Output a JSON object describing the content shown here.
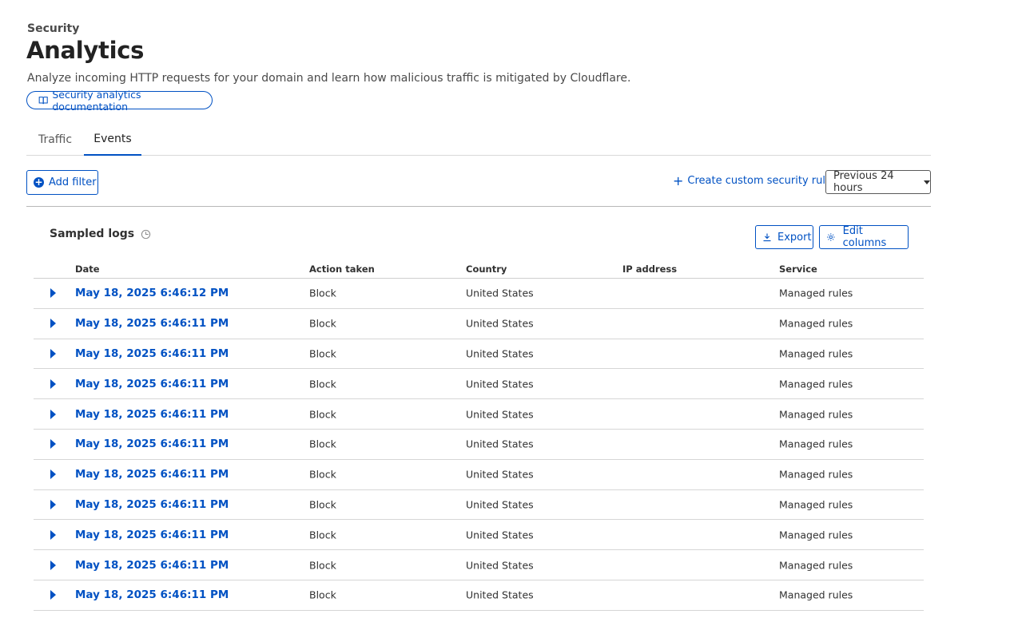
{
  "header": {
    "breadcrumb": "Security",
    "title": "Analytics",
    "description": "Analyze incoming HTTP requests for your domain and learn how malicious traffic is mitigated by Cloudflare.",
    "doc_link": "Security analytics documentation"
  },
  "tabs": [
    {
      "label": "Traffic",
      "active": false
    },
    {
      "label": "Events",
      "active": true
    }
  ],
  "toolbar": {
    "add_filter": "Add filter",
    "create_rule": "Create custom security rule",
    "time_range": "Previous 24 hours"
  },
  "logs": {
    "title": "Sampled logs",
    "export": "Export",
    "edit_columns": "Edit columns",
    "columns": [
      "Date",
      "Action taken",
      "Country",
      "IP address",
      "Service"
    ],
    "rows": [
      {
        "date": "May 18, 2025 6:46:12 PM",
        "action": "Block",
        "country": "United States",
        "ip": "",
        "service": "Managed rules"
      },
      {
        "date": "May 18, 2025 6:46:11 PM",
        "action": "Block",
        "country": "United States",
        "ip": "",
        "service": "Managed rules"
      },
      {
        "date": "May 18, 2025 6:46:11 PM",
        "action": "Block",
        "country": "United States",
        "ip": "",
        "service": "Managed rules"
      },
      {
        "date": "May 18, 2025 6:46:11 PM",
        "action": "Block",
        "country": "United States",
        "ip": "",
        "service": "Managed rules"
      },
      {
        "date": "May 18, 2025 6:46:11 PM",
        "action": "Block",
        "country": "United States",
        "ip": "",
        "service": "Managed rules"
      },
      {
        "date": "May 18, 2025 6:46:11 PM",
        "action": "Block",
        "country": "United States",
        "ip": "",
        "service": "Managed rules"
      },
      {
        "date": "May 18, 2025 6:46:11 PM",
        "action": "Block",
        "country": "United States",
        "ip": "",
        "service": "Managed rules"
      },
      {
        "date": "May 18, 2025 6:46:11 PM",
        "action": "Block",
        "country": "United States",
        "ip": "",
        "service": "Managed rules"
      },
      {
        "date": "May 18, 2025 6:46:11 PM",
        "action": "Block",
        "country": "United States",
        "ip": "",
        "service": "Managed rules"
      },
      {
        "date": "May 18, 2025 6:46:11 PM",
        "action": "Block",
        "country": "United States",
        "ip": "",
        "service": "Managed rules"
      },
      {
        "date": "May 18, 2025 6:46:11 PM",
        "action": "Block",
        "country": "United States",
        "ip": "",
        "service": "Managed rules"
      }
    ]
  },
  "colors": {
    "accent": "#0051c3",
    "text": "#313131"
  }
}
